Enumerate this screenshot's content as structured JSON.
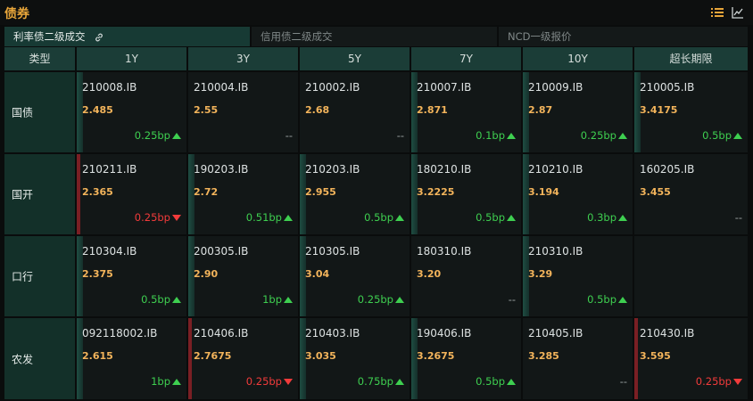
{
  "header": {
    "title": "债券",
    "list_icon": "list-icon",
    "chart_icon": "line-chart-icon"
  },
  "tabs": [
    {
      "label": "利率债二级成交",
      "active": true,
      "icon": "link-icon"
    },
    {
      "label": "信用债二级成交",
      "active": false
    },
    {
      "label": "NCD一级报价",
      "active": false
    }
  ],
  "table": {
    "columns": [
      "类型",
      "1Y",
      "3Y",
      "5Y",
      "7Y",
      "10Y",
      "超长期限"
    ],
    "rows": [
      {
        "type": "国债",
        "cells": [
          {
            "code": "210008.IB",
            "price": "2.485",
            "change": "0.25bp",
            "dir": "up",
            "bar": "green"
          },
          {
            "code": "210004.IB",
            "price": "2.55",
            "change": "--",
            "dir": "flat",
            "bar": "none"
          },
          {
            "code": "210002.IB",
            "price": "2.68",
            "change": "--",
            "dir": "flat",
            "bar": "none"
          },
          {
            "code": "210007.IB",
            "price": "2.871",
            "change": "0.1bp",
            "dir": "up",
            "bar": "green"
          },
          {
            "code": "210009.IB",
            "price": "2.87",
            "change": "0.25bp",
            "dir": "up",
            "bar": "green"
          },
          {
            "code": "210005.IB",
            "price": "3.4175",
            "change": "0.5bp",
            "dir": "up",
            "bar": "green"
          }
        ]
      },
      {
        "type": "国开",
        "cells": [
          {
            "code": "210211.IB",
            "price": "2.365",
            "change": "0.25bp",
            "dir": "down",
            "bar": "red"
          },
          {
            "code": "190203.IB",
            "price": "2.72",
            "change": "0.51bp",
            "dir": "up",
            "bar": "green"
          },
          {
            "code": "210203.IB",
            "price": "2.955",
            "change": "0.5bp",
            "dir": "up",
            "bar": "green"
          },
          {
            "code": "180210.IB",
            "price": "3.2225",
            "change": "0.5bp",
            "dir": "up",
            "bar": "green"
          },
          {
            "code": "210210.IB",
            "price": "3.194",
            "change": "0.3bp",
            "dir": "up",
            "bar": "green"
          },
          {
            "code": "160205.IB",
            "price": "3.455",
            "change": "--",
            "dir": "flat",
            "bar": "none"
          }
        ]
      },
      {
        "type": "口行",
        "cells": [
          {
            "code": "210304.IB",
            "price": "2.375",
            "change": "0.5bp",
            "dir": "up",
            "bar": "green"
          },
          {
            "code": "200305.IB",
            "price": "2.90",
            "change": "1bp",
            "dir": "up",
            "bar": "green"
          },
          {
            "code": "210305.IB",
            "price": "3.04",
            "change": "0.25bp",
            "dir": "up",
            "bar": "green"
          },
          {
            "code": "180310.IB",
            "price": "3.20",
            "change": "--",
            "dir": "flat",
            "bar": "none"
          },
          {
            "code": "210310.IB",
            "price": "3.29",
            "change": "0.5bp",
            "dir": "up",
            "bar": "green"
          },
          {
            "empty": true
          }
        ]
      },
      {
        "type": "农发",
        "cells": [
          {
            "code": "092118002.IB",
            "price": "2.615",
            "change": "1bp",
            "dir": "up",
            "bar": "green"
          },
          {
            "code": "210406.IB",
            "price": "2.7675",
            "change": "0.25bp",
            "dir": "down",
            "bar": "red"
          },
          {
            "code": "210403.IB",
            "price": "3.035",
            "change": "0.75bp",
            "dir": "up",
            "bar": "green"
          },
          {
            "code": "190406.IB",
            "price": "3.2675",
            "change": "0.5bp",
            "dir": "up",
            "bar": "green"
          },
          {
            "code": "210405.IB",
            "price": "3.285",
            "change": "--",
            "dir": "flat",
            "bar": "none"
          },
          {
            "code": "210430.IB",
            "price": "3.595",
            "change": "0.25bp",
            "dir": "down",
            "bar": "red"
          }
        ]
      }
    ]
  },
  "colors": {
    "accent": "#e8a63a",
    "up": "#3ecf50",
    "down": "#f23b3b",
    "price": "#f3b45b",
    "header_bg": "#1b3d37",
    "type_bg": "#133029",
    "cell_bg": "#121717"
  }
}
